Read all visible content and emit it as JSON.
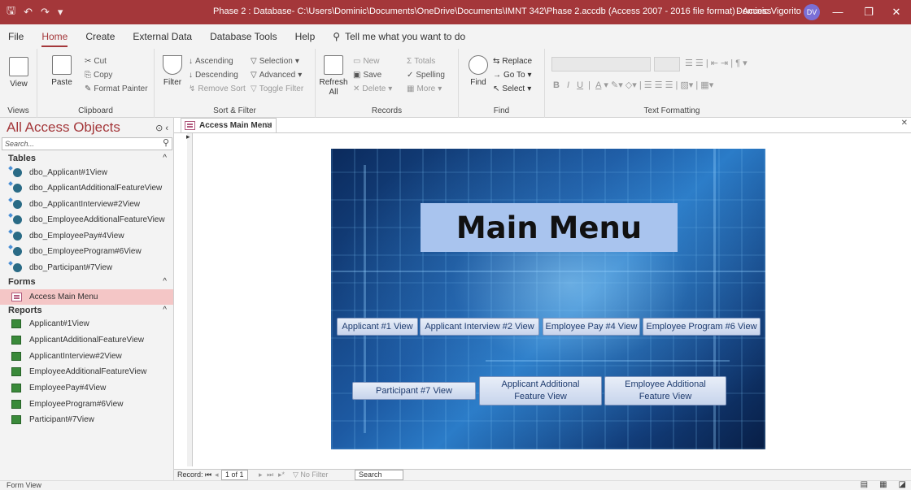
{
  "titlebar": {
    "title": "Phase 2 : Database- C:\\Users\\Dominic\\Documents\\OneDrive\\Documents\\IMNT 342\\Phase 2.accdb (Access 2007 - 2016 file format)  -  Access",
    "user_name": "Dominic Vigorito",
    "user_initials": "DV"
  },
  "menu": {
    "tabs": [
      "File",
      "Home",
      "Create",
      "External Data",
      "Database Tools",
      "Help"
    ],
    "tell_me": "Tell me what you want to do"
  },
  "ribbon": {
    "views": {
      "label": "View",
      "group": "Views"
    },
    "clipboard": {
      "paste": "Paste",
      "cut": "Cut",
      "copy": "Copy",
      "format_painter": "Format Painter",
      "group": "Clipboard"
    },
    "sort_filter": {
      "filter": "Filter",
      "ascending": "Ascending",
      "descending": "Descending",
      "remove_sort": "Remove Sort",
      "selection": "Selection",
      "advanced": "Advanced",
      "toggle_filter": "Toggle Filter",
      "group": "Sort & Filter"
    },
    "records": {
      "refresh": "Refresh",
      "refresh_all": "All",
      "new": "New",
      "save": "Save",
      "delete": "Delete",
      "totals": "Totals",
      "spelling": "Spelling",
      "more": "More",
      "group": "Records"
    },
    "find": {
      "find": "Find",
      "replace": "Replace",
      "go_to": "Go To",
      "select": "Select",
      "group": "Find"
    },
    "text_formatting": {
      "group": "Text Formatting"
    }
  },
  "nav": {
    "title": "All Access Objects",
    "search_placeholder": "Search...",
    "sections": {
      "tables": {
        "label": "Tables",
        "items": [
          "dbo_Applicant#1View",
          "dbo_ApplicantAdditionalFeatureView",
          "dbo_ApplicantInterview#2View",
          "dbo_EmployeeAdditionalFeatureView",
          "dbo_EmployeePay#4View",
          "dbo_EmployeeProgram#6View",
          "dbo_Participant#7View"
        ]
      },
      "forms": {
        "label": "Forms",
        "items": [
          "Access Main Menu"
        ]
      },
      "reports": {
        "label": "Reports",
        "items": [
          "Applicant#1View",
          "ApplicantAdditionalFeatureView",
          "ApplicantInterview#2View",
          "EmployeeAdditionalFeatureView",
          "EmployeePay#4View",
          "EmployeeProgram#6View",
          "Participant#7View"
        ]
      }
    }
  },
  "document": {
    "tab_label": "Access Main Menu",
    "form_title": "Main Menu",
    "buttons": {
      "applicant1": "Applicant #1 View",
      "interview2": "Applicant Interview #2 View",
      "pay4": "Employee Pay #4 View",
      "program6": "Employee Program #6 View",
      "participant7": "Participant #7 View",
      "applicant_additional": "Applicant Additional Feature View",
      "employee_additional": "Employee Additional Feature View"
    }
  },
  "record_nav": {
    "label": "Record:",
    "position": "1 of 1",
    "filter": "No Filter",
    "search": "Search"
  },
  "status": {
    "view": "Form View"
  },
  "colors": {
    "accent": "#a4373a",
    "selected_item": "#f4c6c6"
  }
}
